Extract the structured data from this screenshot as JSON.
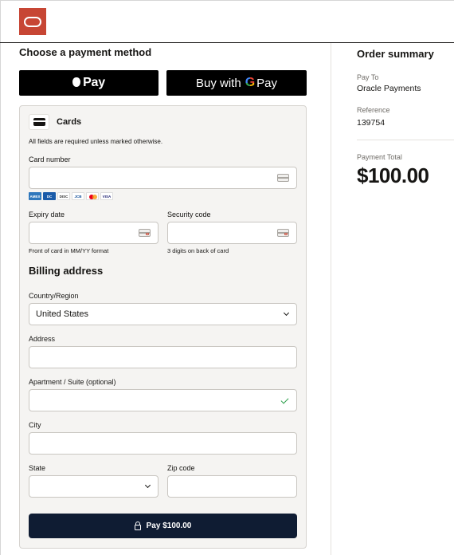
{
  "header": {
    "logo_name": "oracle-logo",
    "logo_color": "#c74634"
  },
  "payment": {
    "section_title": "Choose a payment method",
    "apple_pay_label": "Pay",
    "google_pay_prefix": "Buy with",
    "google_pay_g": "G",
    "google_pay_suffix": "Pay",
    "cards_title": "Cards",
    "required_note": "All fields are required unless marked otherwise.",
    "card_number": {
      "label": "Card number",
      "value": ""
    },
    "brands": [
      "AMEX",
      "DC",
      "DISC",
      "JCB",
      "MC",
      "VISA"
    ],
    "expiry": {
      "label": "Expiry date",
      "value": "",
      "helper": "Front of card in MM/YY format"
    },
    "security": {
      "label": "Security code",
      "value": "",
      "helper": "3 digits on back of card"
    }
  },
  "billing": {
    "title": "Billing address",
    "country": {
      "label": "Country/Region",
      "value": "United States"
    },
    "address": {
      "label": "Address",
      "value": ""
    },
    "apartment": {
      "label": "Apartment / Suite (optional)",
      "value": ""
    },
    "city": {
      "label": "City",
      "value": ""
    },
    "state": {
      "label": "State",
      "value": ""
    },
    "zip": {
      "label": "Zip code",
      "value": ""
    }
  },
  "pay_button": {
    "label": "Pay $100.00",
    "color": "#0f1c33"
  },
  "summary": {
    "title": "Order summary",
    "pay_to_label": "Pay To",
    "pay_to_value": "Oracle Payments",
    "reference_label": "Reference",
    "reference_value": "139754",
    "total_label": "Payment Total",
    "total_value": "$100.00"
  }
}
